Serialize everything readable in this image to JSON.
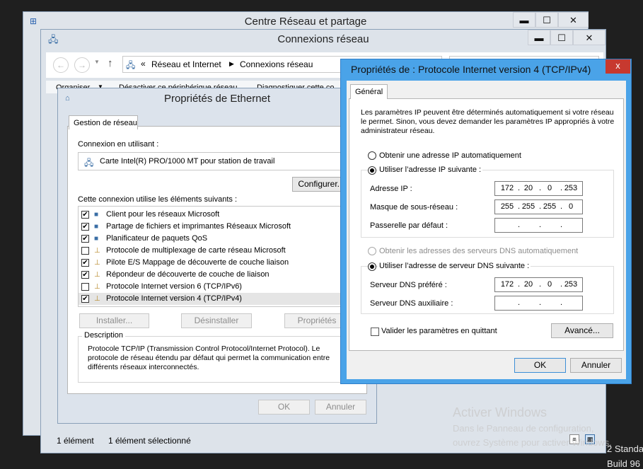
{
  "colors": {
    "dialog_border": "#3d8fd6",
    "close_red": "#c7392f",
    "desktop": "#1f1f1f"
  },
  "centre_window": {
    "title": "Centre Réseau et partage"
  },
  "connexions_window": {
    "title": "Connexions réseau",
    "breadcrumb": {
      "prefix": "«",
      "item1": "Réseau et Internet",
      "item2": "Connexions réseau"
    },
    "toolbar": {
      "organize": "Organiser",
      "disable": "Désactiver ce périphérique réseau",
      "diagnose": "Diagnostiquer cette co"
    },
    "status": {
      "count": "1 élément",
      "selected": "1 élément sélectionné"
    }
  },
  "ethernet_dialog": {
    "title": "Propriétés de Ethernet",
    "tab": "Gestion de réseau",
    "connect_using_label": "Connexion en utilisant :",
    "adapter": "Carte Intel(R) PRO/1000 MT pour station de travail",
    "configure_button": "Configurer...",
    "items_label": "Cette connexion utilise les éléments suivants :",
    "items": [
      {
        "label": "Client pour les réseaux Microsoft",
        "checked": "✔"
      },
      {
        "label": "Partage de fichiers et imprimantes Réseaux Microsoft",
        "checked": "✔"
      },
      {
        "label": "Planificateur de paquets QoS",
        "checked": "✔"
      },
      {
        "label": "Protocole de multiplexage de carte réseau Microsoft",
        "checked": ""
      },
      {
        "label": "Pilote E/S Mappage de découverte de couche liaison",
        "checked": "✔"
      },
      {
        "label": "Répondeur de découverte de couche de liaison",
        "checked": "✔"
      },
      {
        "label": "Protocole Internet version 6 (TCP/IPv6)",
        "checked": ""
      },
      {
        "label": "Protocole Internet version 4 (TCP/IPv4)",
        "checked": "✔"
      }
    ],
    "install_button": "Installer...",
    "uninstall_button": "Désinstaller",
    "properties_button": "Propriétés",
    "description_title": "Description",
    "description_text": "Protocole TCP/IP (Transmission Control Protocol/Internet Protocol). Le protocole de réseau étendu par défaut qui permet la communication entre différents réseaux interconnectés.",
    "ok_button": "OK",
    "cancel_button": "Annuler"
  },
  "ipv4_dialog": {
    "title": "Propriétés de : Protocole Internet version 4 (TCP/IPv4)",
    "close": "x",
    "tab": "Général",
    "intro": "Les paramètres IP peuvent être déterminés automatiquement si votre réseau le permet. Sinon, vous devez demander les paramètres IP appropriés à votre administrateur réseau.",
    "auto_ip_label": "Obtenir une adresse IP automatiquement",
    "manual_ip_label": "Utiliser l’adresse IP suivante :",
    "ip_label": "Adresse IP :",
    "ip_value": [
      "172",
      "20",
      "0",
      "253"
    ],
    "mask_label": "Masque de sous-réseau :",
    "mask_value": [
      "255",
      "255",
      "255",
      "0"
    ],
    "gateway_label": "Passerelle par défaut :",
    "gateway_value": [
      "",
      "",
      "",
      ""
    ],
    "auto_dns_label": "Obtenir les adresses des serveurs DNS automatiquement",
    "manual_dns_label": "Utiliser l’adresse de serveur DNS suivante :",
    "dns_pref_label": "Serveur DNS préféré :",
    "dns_pref_value": [
      "172",
      "20",
      "0",
      "253"
    ],
    "dns_alt_label": "Serveur DNS auxiliaire :",
    "dns_alt_value": [
      "",
      "",
      "",
      ""
    ],
    "validate_label": "Valider les paramètres en quittant",
    "advanced_button": "Avancé...",
    "ok_button": "OK",
    "cancel_button": "Annuler"
  },
  "watermark": {
    "line1": "Activer Windows",
    "line2": "Dans le Panneau de configuration,",
    "line3": "ouvrez Système pour activer Windows.",
    "edge1": "2 Standa",
    "edge2": "Build 96"
  }
}
